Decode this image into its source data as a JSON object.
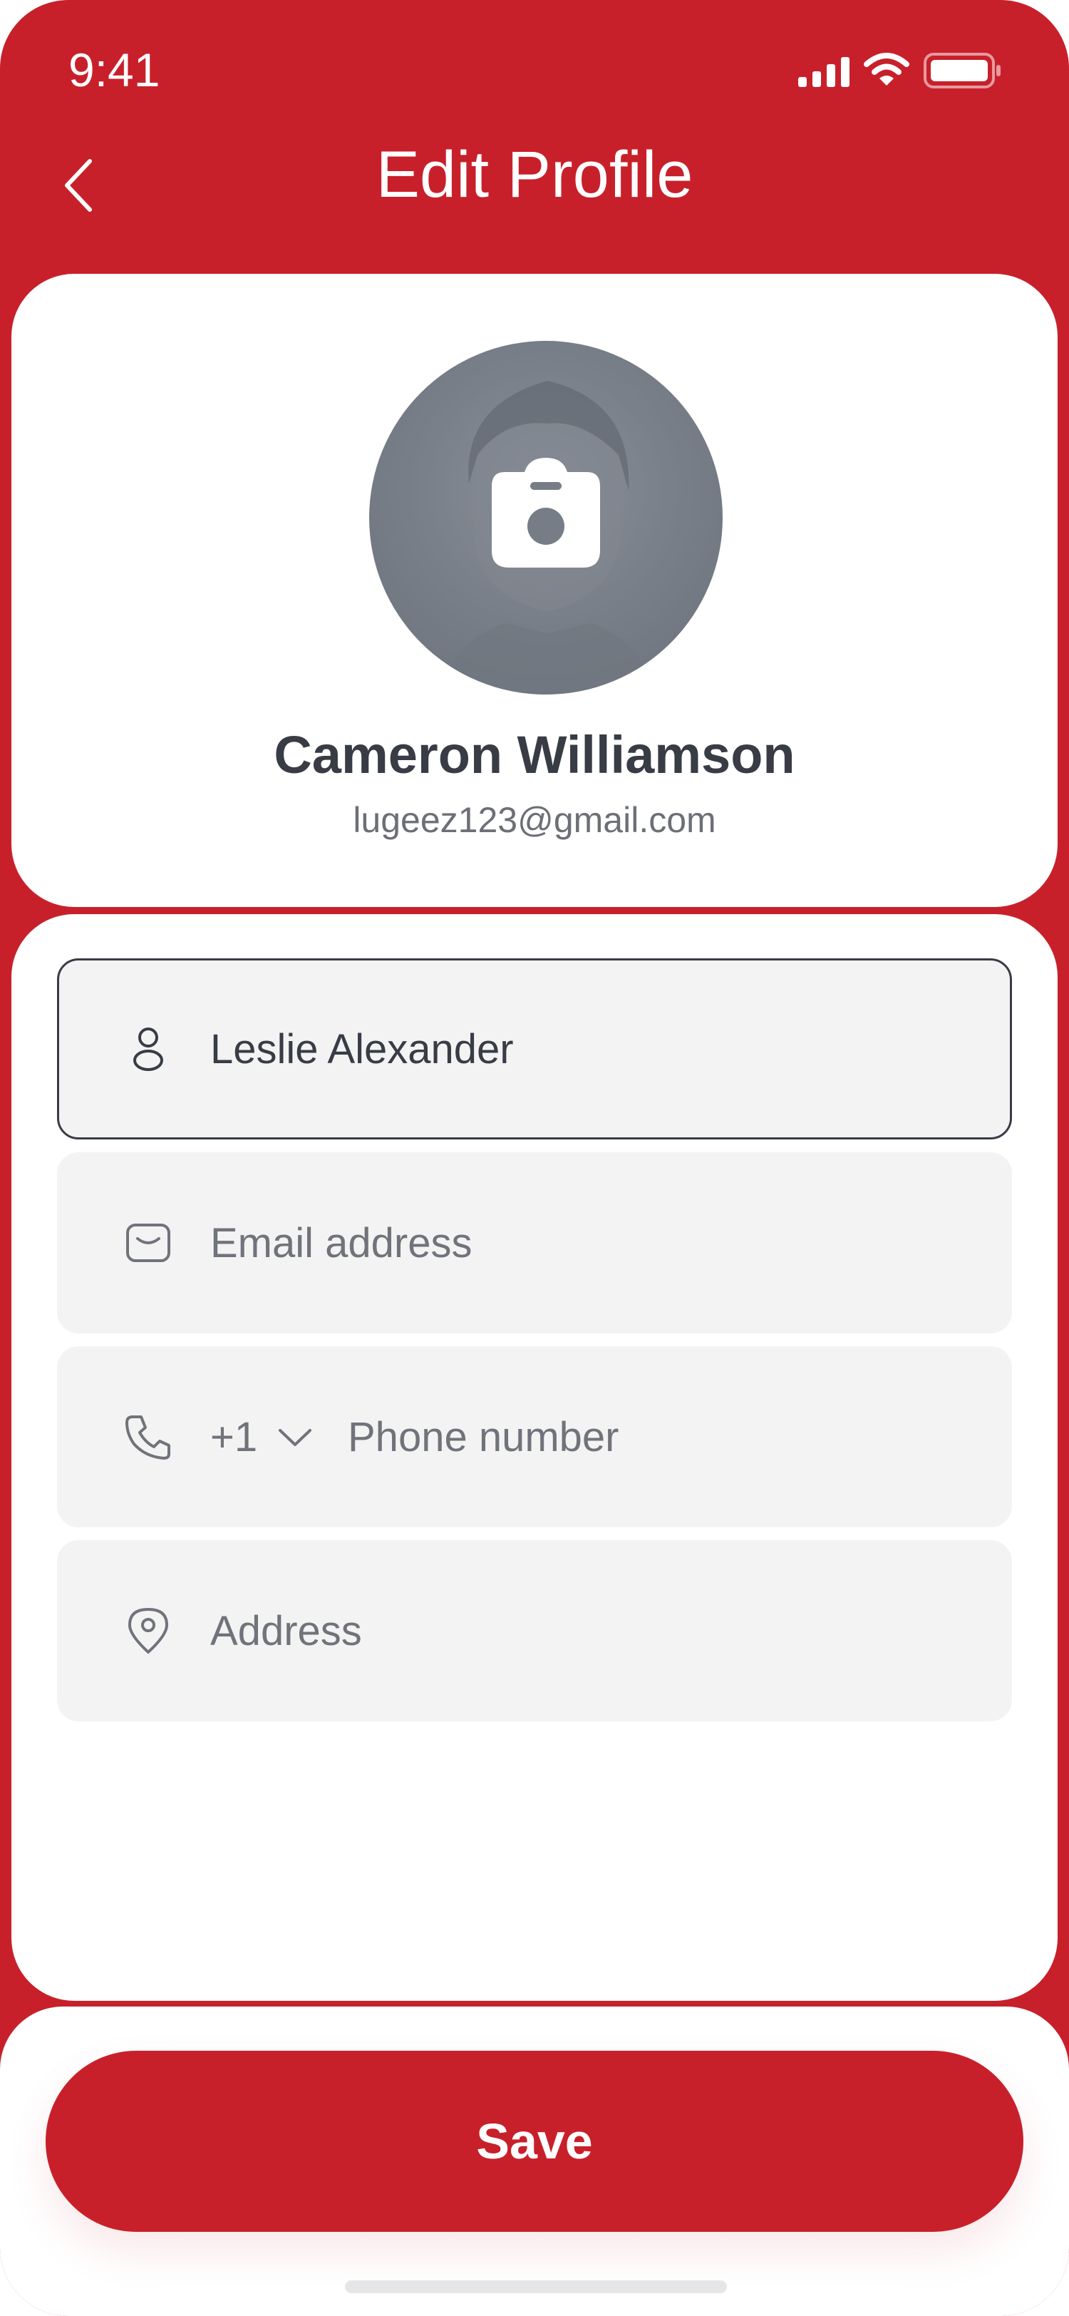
{
  "status_bar": {
    "time": "9:41",
    "icons": [
      "signal-icon",
      "wifi-icon",
      "battery-icon"
    ]
  },
  "header": {
    "back_icon": "chevron-left-icon",
    "title": "Edit Profile"
  },
  "profile": {
    "name": "Cameron Williamson",
    "email": "lugeez123@gmail.com",
    "avatar_overlay_icon": "camera-icon"
  },
  "form": {
    "name_field": {
      "icon": "user-icon",
      "value": "Leslie Alexander",
      "focused": true
    },
    "email_field": {
      "icon": "mail-icon",
      "placeholder": "Email address"
    },
    "phone_field": {
      "icon": "phone-icon",
      "country_code": "+1",
      "placeholder": "Phone number"
    },
    "address_field": {
      "icon": "location-pin-icon",
      "placeholder": "Address"
    }
  },
  "footer": {
    "save_label": "Save"
  },
  "colors": {
    "brand": "#c8202a",
    "text_dark": "#383c45",
    "text_muted": "#70737a",
    "field_background": "#f3f3f3",
    "surface": "#ffffff"
  }
}
